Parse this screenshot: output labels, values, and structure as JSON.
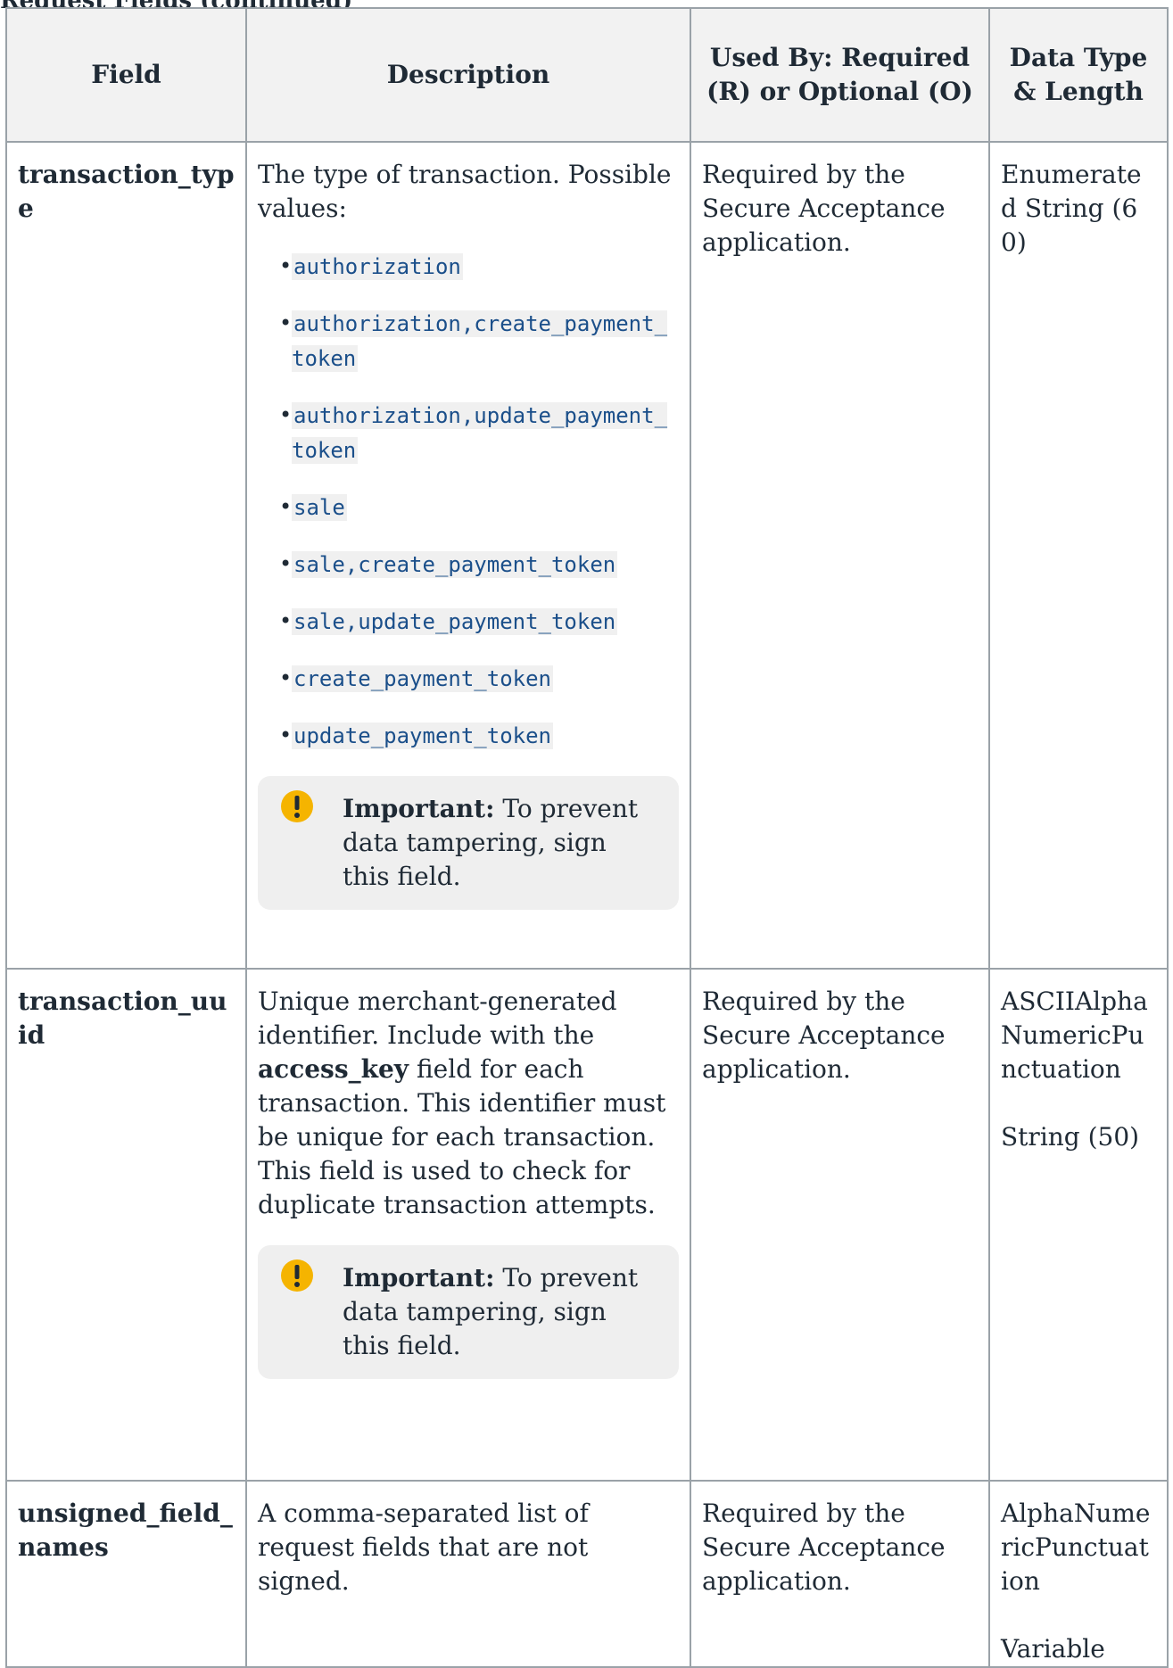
{
  "caption": "Request Fields (continued)",
  "table": {
    "headers": [
      "Field",
      "Description",
      "Used By: Required (R) or Optional (O)",
      "Data Type & Length"
    ],
    "rows": [
      {
        "field": "transaction_type",
        "description": "The type of transaction. Possible values:",
        "values": [
          "authorization",
          "authorization,create_payment_token",
          "authorization,update_payment_token",
          "sale",
          "sale,create_payment_token",
          "sale,update_payment_token",
          "create_payment_token",
          "update_payment_token"
        ],
        "note_label": "Important:",
        "note_text": "To prevent data tampering, sign this field.",
        "used_by": "Required by the Secure Acceptance application.",
        "data_type": "Enumerated String (60)"
      },
      {
        "field": "transaction_uuid",
        "description_pre": "Unique merchant-generated identifier. Include with the",
        "description_bold": "access_key",
        "description_post": "field for each transaction. This identifier must be unique for each transaction. This field is used to check for duplicate transaction attempts.",
        "note_label": "Important:",
        "note_text": "To prevent data tampering, sign this field.",
        "used_by": "Required by the Secure Acceptance application.",
        "data_type_1": "ASCIIAlphaNumericPunctuation",
        "data_type_2": "String (50)"
      },
      {
        "field": "unsigned_field_names",
        "description": "A comma-separated list of request fields that are not signed.",
        "used_by": "Required by the Secure Acceptance application.",
        "data_type_1": "AlphaNumericPunctuation",
        "data_type_2": "Variable"
      }
    ]
  },
  "colors": {
    "text": "#1f2a35",
    "border": "#9aa2a8",
    "header_bg": "#f2f2f2",
    "code": "#1b4f8a",
    "note_bg": "#efefef",
    "warning": "#f5b400"
  },
  "icons": {
    "important": "exclamation-warning-icon"
  }
}
